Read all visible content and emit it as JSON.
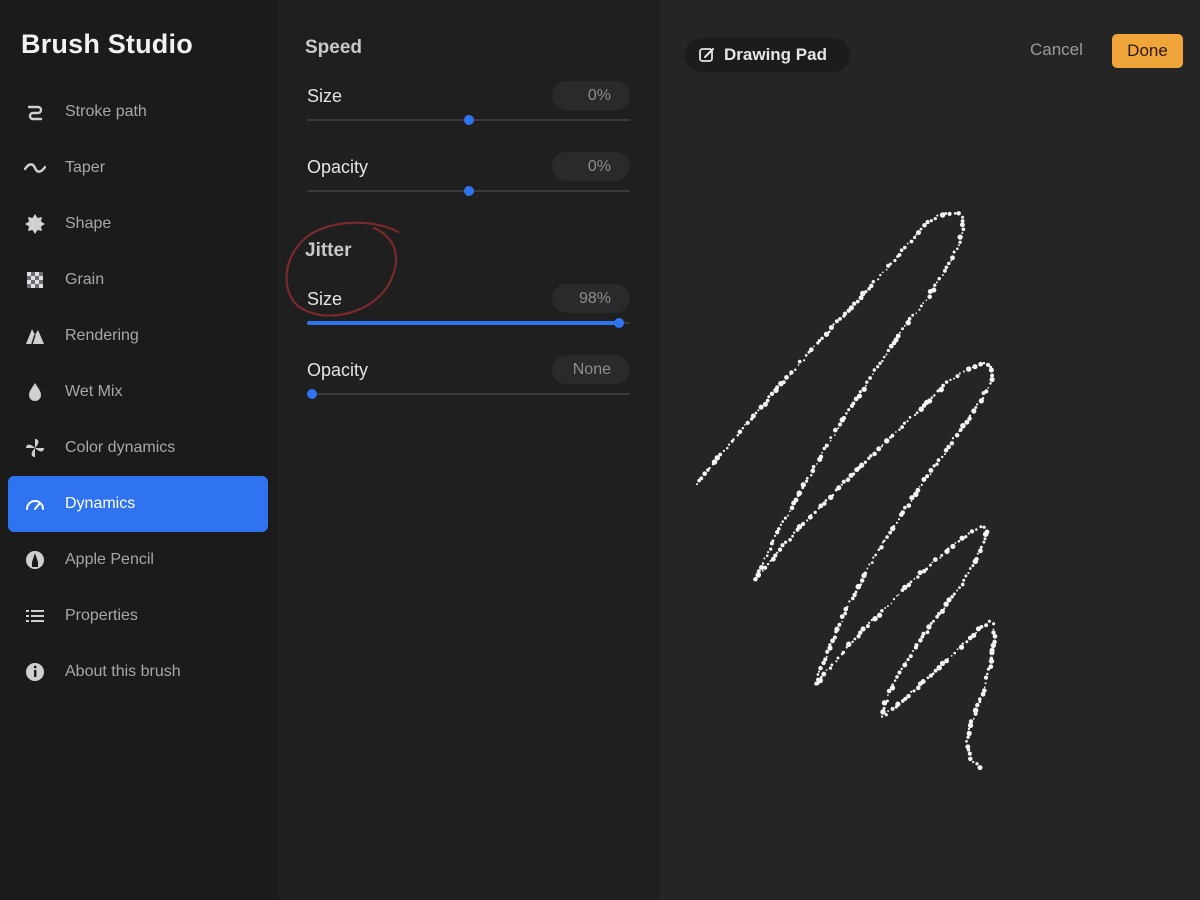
{
  "app": {
    "title": "Brush Studio"
  },
  "sidebar": {
    "items": [
      {
        "label": "Stroke path",
        "icon": "stroke-path-icon",
        "active": false
      },
      {
        "label": "Taper",
        "icon": "taper-icon",
        "active": false
      },
      {
        "label": "Shape",
        "icon": "shape-icon",
        "active": false
      },
      {
        "label": "Grain",
        "icon": "grain-icon",
        "active": false
      },
      {
        "label": "Rendering",
        "icon": "rendering-icon",
        "active": false
      },
      {
        "label": "Wet Mix",
        "icon": "wet-mix-icon",
        "active": false
      },
      {
        "label": "Color dynamics",
        "icon": "color-dynamics-icon",
        "active": false
      },
      {
        "label": "Dynamics",
        "icon": "dynamics-icon",
        "active": true
      },
      {
        "label": "Apple Pencil",
        "icon": "apple-pencil-icon",
        "active": false
      },
      {
        "label": "Properties",
        "icon": "properties-icon",
        "active": false
      },
      {
        "label": "About this brush",
        "icon": "info-icon",
        "active": false
      }
    ]
  },
  "settings": {
    "speed": {
      "title": "Speed",
      "size": {
        "label": "Size",
        "value": "0%",
        "level": 0.5
      },
      "opacity": {
        "label": "Opacity",
        "value": "0%",
        "level": 0.5
      }
    },
    "jitter": {
      "title": "Jitter",
      "size": {
        "label": "Size",
        "value": "98%",
        "level": 0.98
      },
      "opacity": {
        "label": "Opacity",
        "value": "None",
        "level": 0.0
      }
    }
  },
  "pad": {
    "title": "Drawing Pad",
    "cancel_label": "Cancel",
    "done_label": "Done"
  },
  "colors": {
    "accent": "#2f73f1",
    "done": "#f0a53a",
    "annotation": "#7a2a2c"
  }
}
